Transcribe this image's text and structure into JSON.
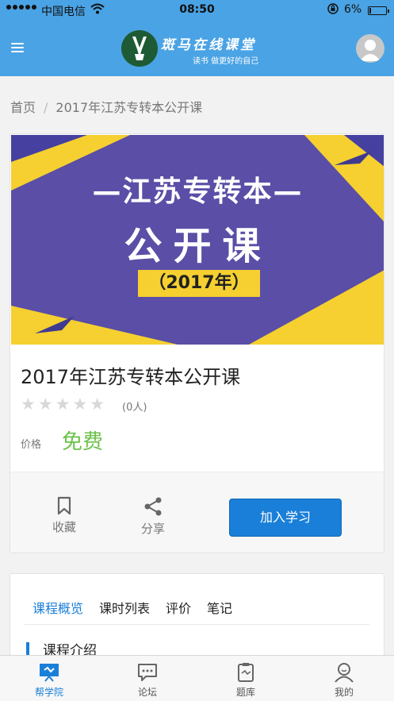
{
  "status_bar": {
    "carrier": "中国电信",
    "time": "08:50",
    "battery_pct": "6%"
  },
  "header": {
    "brand_name": "斑马在线课堂",
    "brand_slogan": "读书  做更好的自己",
    "menu_icon": "hamburger-menu-icon",
    "avatar_icon": "user-avatar-icon"
  },
  "breadcrumb": {
    "home": "首页",
    "separator": "/",
    "current": "2017年江苏专转本公开课"
  },
  "course": {
    "banner": {
      "title": "—江苏专转本—",
      "subtitle": "公开课",
      "year": "（2017年）",
      "background_color": "#5a4ea6",
      "accent_color": "#f5d030"
    },
    "title": "2017年江苏专转本公开课",
    "stars_filled": 0,
    "stars_total": 5,
    "stars_text": "★★★★★",
    "rating_count": "(0人)",
    "price_label": "价格",
    "price_value": "免费",
    "price_color": "#6bc24a"
  },
  "actions": {
    "collect_label": "收藏",
    "share_label": "分享",
    "join_label": "加入学习",
    "join_color": "#1a7fd8"
  },
  "tabs": {
    "items": [
      {
        "label": "课程概览",
        "active": true
      },
      {
        "label": "课时列表",
        "active": false
      },
      {
        "label": "评价",
        "active": false
      },
      {
        "label": "笔记",
        "active": false
      }
    ],
    "section_heading": "课程介绍"
  },
  "bottom_nav": {
    "items": [
      {
        "label": "帮学院",
        "icon": "presentation-board-icon",
        "active": true
      },
      {
        "label": "论坛",
        "icon": "chat-bubble-icon",
        "active": false
      },
      {
        "label": "题库",
        "icon": "clipboard-icon",
        "active": false
      },
      {
        "label": "我的",
        "icon": "user-icon",
        "active": false
      }
    ]
  }
}
